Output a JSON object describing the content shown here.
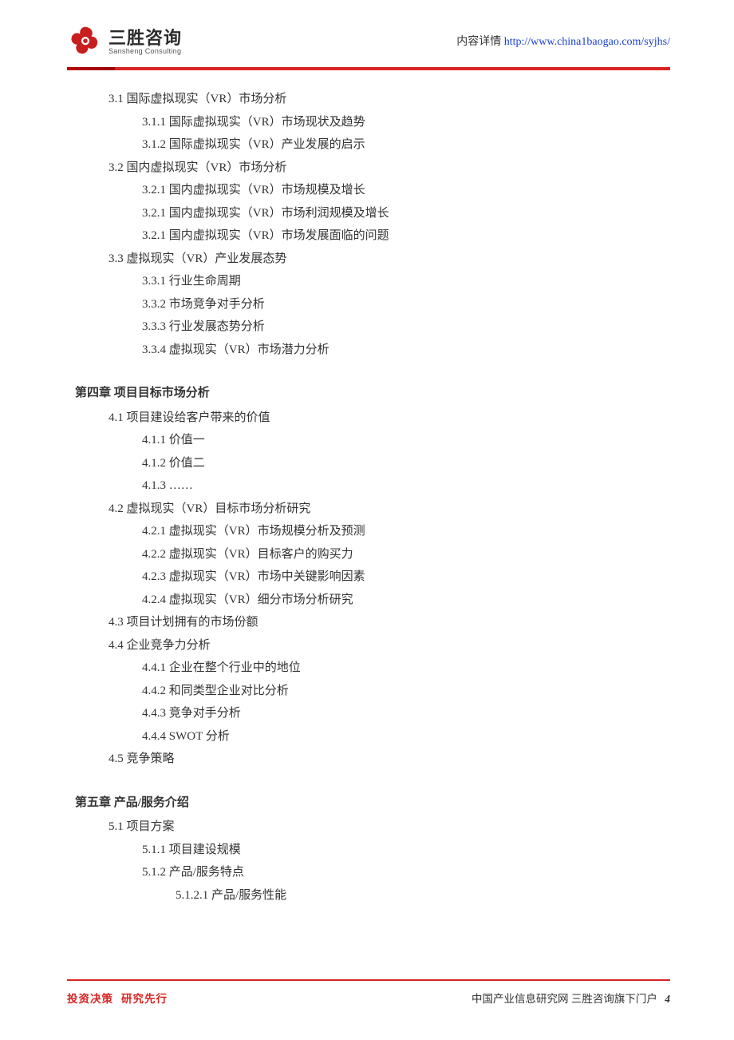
{
  "header": {
    "logo_cn": "三胜咨询",
    "logo_en": "Sansheng Consulting",
    "link_prefix": "内容详情 ",
    "link_url": "http://www.china1baogao.com/syjhs/"
  },
  "toc": [
    {
      "level": "l1",
      "text": "3.1 国际虚拟现实（VR）市场分析"
    },
    {
      "level": "l2",
      "text": "3.1.1 国际虚拟现实（VR）市场现状及趋势"
    },
    {
      "level": "l2",
      "text": "3.1.2 国际虚拟现实（VR）产业发展的启示"
    },
    {
      "level": "l1",
      "text": "3.2 国内虚拟现实（VR）市场分析"
    },
    {
      "level": "l2",
      "text": "3.2.1 国内虚拟现实（VR）市场规模及增长"
    },
    {
      "level": "l2",
      "text": "3.2.1 国内虚拟现实（VR）市场利润规模及增长"
    },
    {
      "level": "l2",
      "text": "3.2.1 国内虚拟现实（VR）市场发展面临的问题"
    },
    {
      "level": "l1",
      "text": "3.3 虚拟现实（VR）产业发展态势"
    },
    {
      "level": "l2",
      "text": "3.3.1 行业生命周期"
    },
    {
      "level": "l2",
      "text": "3.3.2 市场竞争对手分析"
    },
    {
      "level": "l2",
      "text": "3.3.3 行业发展态势分析"
    },
    {
      "level": "l2",
      "text": "3.3.4 虚拟现实（VR）市场潜力分析"
    },
    {
      "level": "chapter",
      "text": "第四章 项目目标市场分析"
    },
    {
      "level": "l1",
      "text": "4.1 项目建设给客户带来的价值"
    },
    {
      "level": "l2",
      "text": "4.1.1 价值一"
    },
    {
      "level": "l2",
      "text": "4.1.2 价值二"
    },
    {
      "level": "l2",
      "text": "4.1.3 ……"
    },
    {
      "level": "l1",
      "text": "4.2 虚拟现实（VR）目标市场分析研究"
    },
    {
      "level": "l2",
      "text": "4.2.1 虚拟现实（VR）市场规模分析及预测"
    },
    {
      "level": "l2",
      "text": "4.2.2 虚拟现实（VR）目标客户的购买力"
    },
    {
      "level": "l2",
      "text": "4.2.3 虚拟现实（VR）市场中关键影响因素"
    },
    {
      "level": "l2",
      "text": "4.2.4 虚拟现实（VR）细分市场分析研究"
    },
    {
      "level": "l1",
      "text": "4.3 项目计划拥有的市场份额"
    },
    {
      "level": "l1",
      "text": "4.4 企业竞争力分析"
    },
    {
      "level": "l2",
      "text": "4.4.1 企业在整个行业中的地位"
    },
    {
      "level": "l2",
      "text": "4.4.2 和同类型企业对比分析"
    },
    {
      "level": "l2",
      "text": "4.4.3 竞争对手分析"
    },
    {
      "level": "l2",
      "text": "4.4.4 SWOT 分析"
    },
    {
      "level": "l1",
      "text": "4.5 竞争策略"
    },
    {
      "level": "chapter",
      "text": "第五章 产品/服务介绍"
    },
    {
      "level": "l1",
      "text": "5.1 项目方案"
    },
    {
      "level": "l2",
      "text": "5.1.1 项目建设规模"
    },
    {
      "level": "l2",
      "text": "5.1.2 产品/服务特点"
    },
    {
      "level": "l3",
      "text": "5.1.2.1 产品/服务性能"
    }
  ],
  "footer": {
    "left_a": "投资决策",
    "left_b": "研究先行",
    "right_text": "中国产业信息研究网  三胜咨询旗下门户",
    "page_number": "4"
  }
}
